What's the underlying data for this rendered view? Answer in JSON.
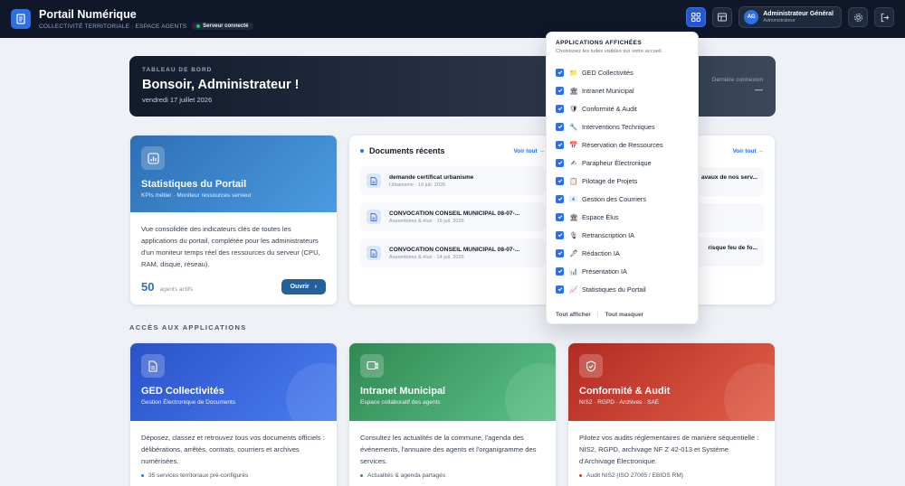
{
  "header": {
    "title": "Portail Numérique",
    "subtitle": "COLLECTIVITÉ TERRITORIALE · ESPACE AGENTS",
    "server_status": "Serveur connecté",
    "user": {
      "initials": "AG",
      "name": "Administrateur Général",
      "role": "Administrateur"
    }
  },
  "hero": {
    "kicker": "TABLEAU DE BORD",
    "greeting": "Bonsoir, Administrateur !",
    "date": "vendredi 17 juillet 2026",
    "last_login_label": "Dernière connexion",
    "last_login_value": "—"
  },
  "stats_card": {
    "title": "Statistiques du Portail",
    "subtitle": "KPIs métier · Moniteur ressources serveur",
    "description": "Vue consolidée des indicateurs clés de toutes les applications du portail, complétée pour les administrateurs d'un moniteur temps réel des ressources du serveur (CPU, RAM, disque, réseau).",
    "count": "50",
    "count_label": "agents actifs",
    "open_label": "Ouvrir"
  },
  "documents": {
    "title": "Documents récents",
    "see_all": "Voir tout →",
    "items": [
      {
        "title": "demande certificat urbanisme",
        "meta": "Urbanisme · 16 juil. 2026"
      },
      {
        "title": "CONVOCATION CONSEIL MUNICIPAL 08-07-...",
        "meta": "Assemblées & élus · 16 juil. 2026"
      },
      {
        "title": "CONVOCATION CONSEIL MUNICIPAL 08-07-...",
        "meta": "Assemblées & élus · 14 juil. 2026"
      }
    ]
  },
  "news": {
    "see_all": "Voir tout →",
    "items": [
      {
        "title": "avaux de nos serv..."
      },
      {
        "title": ""
      },
      {
        "title": "risque feu de fo..."
      }
    ]
  },
  "section": {
    "title": "ACCÈS AUX APPLICATIONS"
  },
  "apps": [
    {
      "title": "GED Collectivités",
      "subtitle": "Gestion Électronique de Documents",
      "description": "Déposez, classez et retrouvez tous vos documents officiels : délibérations, arrêtés, contrats, courriers et archives numérisées.",
      "bullet": "35 services territoriaux pré-configurés",
      "bullet_color": "#2f6fe4"
    },
    {
      "title": "Intranet Municipal",
      "subtitle": "Espace collaboratif des agents",
      "description": "Consultez les actualités de la commune, l'agenda des événements, l'annuaire des agents et l'organigramme des services.",
      "bullet": "Actualités & agenda partagés",
      "bullet_color": "#2f8a52"
    },
    {
      "title": "Conformité & Audit",
      "subtitle": "NIS2 · RGPD · Archives · SAE",
      "description": "Pilotez vos audits réglementaires de manière séquentielle : NIS2, RGPD, archivage NF Z 42-013 et Système d'Archivage Électronique.",
      "bullet": "Audit NIS2 (ISO 27005 / EBIOS RM)",
      "bullet_color": "#d23b2c"
    }
  ],
  "dropdown": {
    "title": "APPLICATIONS AFFICHÉES",
    "subtitle": "Choisissez les tuiles visibles sur votre accueil.",
    "items": [
      {
        "emoji": "📁",
        "label": "GED Collectivités"
      },
      {
        "emoji": "🏛",
        "label": "Intranet Municipal"
      },
      {
        "emoji": "🛡",
        "label": "Conformité & Audit"
      },
      {
        "emoji": "🔧",
        "label": "Interventions Techniques"
      },
      {
        "emoji": "📅",
        "label": "Réservation de Ressources"
      },
      {
        "emoji": "✍",
        "label": "Parapheur Électronique"
      },
      {
        "emoji": "📋",
        "label": "Pilotage de Projets"
      },
      {
        "emoji": "📧",
        "label": "Gestion des Courriers"
      },
      {
        "emoji": "🏛",
        "label": "Espace Élus"
      },
      {
        "emoji": "🎙",
        "label": "Retranscription IA"
      },
      {
        "emoji": "🖋",
        "label": "Rédaction IA"
      },
      {
        "emoji": "📊",
        "label": "Présentation IA"
      },
      {
        "emoji": "📈",
        "label": "Statistiques du Portail"
      }
    ],
    "show_all": "Tout afficher",
    "hide_all": "Tout masquer"
  },
  "colors": {
    "accent": "#2f6fe4",
    "topbar": "#0f1728"
  }
}
